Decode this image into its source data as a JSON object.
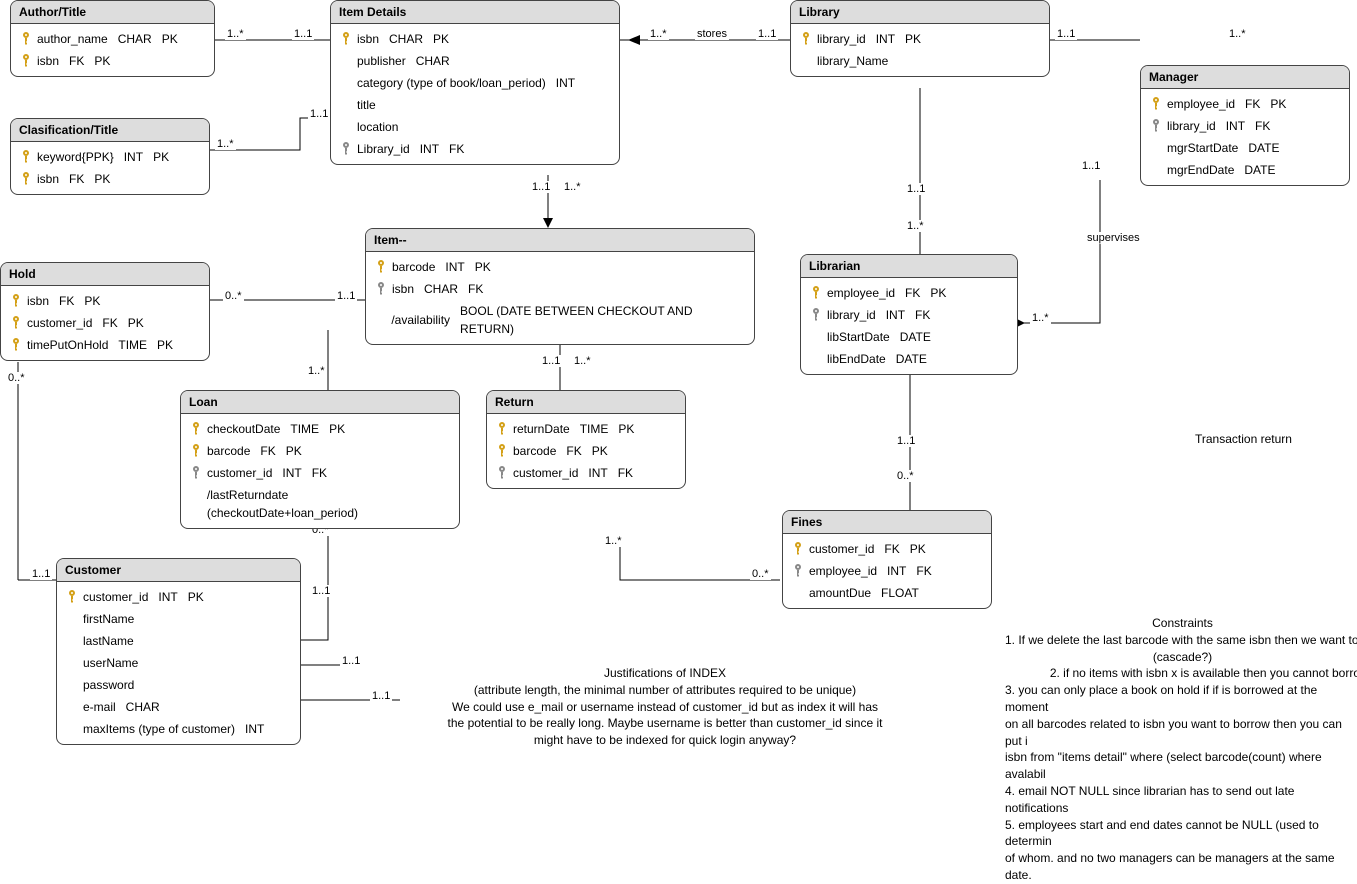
{
  "entities": {
    "authorTitle": {
      "title": "Author/Title",
      "attrs": [
        {
          "key": "pk",
          "name": "author_name",
          "type": "CHAR",
          "keys": "PK"
        },
        {
          "key": "pk",
          "name": "isbn",
          "type": "FK",
          "keys": "PK"
        }
      ]
    },
    "classificationTitle": {
      "title": "Clasification/Title",
      "attrs": [
        {
          "key": "pk",
          "name": "keyword{PPK}",
          "type": "INT",
          "keys": "PK"
        },
        {
          "key": "pk",
          "name": "isbn",
          "type": "FK",
          "keys": "PK"
        }
      ]
    },
    "itemDetails": {
      "title": "Item Details",
      "attrs": [
        {
          "key": "pk",
          "name": "isbn",
          "type": "CHAR",
          "keys": "PK"
        },
        {
          "key": "",
          "name": "publisher",
          "type": "CHAR",
          "keys": ""
        },
        {
          "key": "",
          "name": "category (type of book/loan_period)",
          "type": "INT",
          "keys": ""
        },
        {
          "key": "",
          "name": "title",
          "type": "",
          "keys": ""
        },
        {
          "key": "",
          "name": "location",
          "type": "",
          "keys": ""
        },
        {
          "key": "fk",
          "name": "Library_id",
          "type": "INT",
          "keys": "FK"
        }
      ]
    },
    "hold": {
      "title": "Hold",
      "attrs": [
        {
          "key": "pk",
          "name": "isbn",
          "type": "FK",
          "keys": "PK"
        },
        {
          "key": "pk",
          "name": "customer_id",
          "type": "FK",
          "keys": "PK"
        },
        {
          "key": "pk",
          "name": "timePutOnHold",
          "type": "TIME",
          "keys": "PK"
        }
      ]
    },
    "item": {
      "title": "Item--",
      "attrs": [
        {
          "key": "pk",
          "name": "barcode",
          "type": "INT",
          "keys": "PK"
        },
        {
          "key": "fk",
          "name": "isbn",
          "type": "CHAR",
          "keys": "FK"
        },
        {
          "key": "",
          "name": "/availability",
          "type": "BOOL (DATE BETWEEN CHECKOUT AND RETURN)",
          "keys": ""
        }
      ]
    },
    "loan": {
      "title": "Loan",
      "attrs": [
        {
          "key": "pk",
          "name": "checkoutDate",
          "type": "TIME",
          "keys": "PK"
        },
        {
          "key": "pk",
          "name": "barcode",
          "type": "FK",
          "keys": "PK"
        },
        {
          "key": "fk",
          "name": "customer_id",
          "type": "INT",
          "keys": "FK"
        },
        {
          "key": "",
          "name": "/lastReturndate (checkoutDate+loan_period)",
          "type": "",
          "keys": ""
        }
      ]
    },
    "return": {
      "title": "Return",
      "attrs": [
        {
          "key": "pk",
          "name": "returnDate",
          "type": "TIME",
          "keys": "PK"
        },
        {
          "key": "pk",
          "name": "barcode",
          "type": "FK",
          "keys": "PK"
        },
        {
          "key": "fk",
          "name": "customer_id",
          "type": "INT",
          "keys": "FK"
        }
      ]
    },
    "customer": {
      "title": "Customer",
      "attrs": [
        {
          "key": "pk",
          "name": "customer_id",
          "type": "INT",
          "keys": "PK"
        },
        {
          "key": "",
          "name": "firstName",
          "type": "",
          "keys": ""
        },
        {
          "key": "",
          "name": "lastName",
          "type": "",
          "keys": ""
        },
        {
          "key": "",
          "name": "userName",
          "type": "",
          "keys": ""
        },
        {
          "key": "",
          "name": "password",
          "type": "",
          "keys": ""
        },
        {
          "key": "",
          "name": "e-mail",
          "type": "CHAR",
          "keys": ""
        },
        {
          "key": "",
          "name": "maxItems (type of customer)",
          "type": "INT",
          "keys": ""
        }
      ]
    },
    "library": {
      "title": "Library",
      "attrs": [
        {
          "key": "pk",
          "name": "library_id",
          "type": "INT",
          "keys": "PK"
        },
        {
          "key": "",
          "name": "library_Name",
          "type": "",
          "keys": ""
        }
      ]
    },
    "librarian": {
      "title": "Librarian",
      "attrs": [
        {
          "key": "pk",
          "name": "employee_id",
          "type": "FK",
          "keys": "PK"
        },
        {
          "key": "fk",
          "name": "library_id",
          "type": "INT",
          "keys": "FK"
        },
        {
          "key": "",
          "name": "libStartDate",
          "type": "DATE",
          "keys": ""
        },
        {
          "key": "",
          "name": "libEndDate",
          "type": "DATE",
          "keys": ""
        }
      ]
    },
    "manager": {
      "title": "Manager",
      "attrs": [
        {
          "key": "pk",
          "name": "employee_id",
          "type": "FK",
          "keys": "PK"
        },
        {
          "key": "fk",
          "name": "library_id",
          "type": "INT",
          "keys": "FK"
        },
        {
          "key": "",
          "name": "mgrStartDate",
          "type": "DATE",
          "keys": ""
        },
        {
          "key": "",
          "name": "mgrEndDate",
          "type": "DATE",
          "keys": ""
        }
      ]
    },
    "fines": {
      "title": "Fines",
      "attrs": [
        {
          "key": "pk",
          "name": "customer_id",
          "type": "FK",
          "keys": "PK"
        },
        {
          "key": "fk",
          "name": "employee_id",
          "type": "INT",
          "keys": "FK"
        },
        {
          "key": "",
          "name": "amountDue",
          "type": "FLOAT",
          "keys": ""
        }
      ]
    }
  },
  "labels": {
    "stores": "stores",
    "supervises": "supervises",
    "transactionReturn": "Transaction return"
  },
  "cardinalities": {
    "c1": "1..*",
    "c2": "1..1",
    "c3": "0..*",
    "c4": "1..1",
    "c5": "1..*",
    "c6": "1..1",
    "c7": "1..*",
    "c8": "1..1",
    "c9": "0..*",
    "c10": "1..1",
    "c11": "1..*",
    "c12": "1..1",
    "c13": "1..*",
    "c14": "1..1",
    "c15": "1..*",
    "c16": "1..1",
    "c17": "0..*",
    "c18": "1..1",
    "c19": "0..*",
    "c20": "1..1",
    "c21": "1..*",
    "c22": "1..1",
    "c23": "1..1",
    "c24": "1..1",
    "c25": "1..1",
    "c26": "1..*",
    "c27": "1..*",
    "c28": "1..1",
    "c29": "1..1",
    "c30": "1..*"
  },
  "justifications": {
    "title": "Justifications of INDEX",
    "line1": "(attribute length, the  minimal  number  of   attributes  required to be unique)",
    "line2": "We could use e_mail or username instead of customer_id but as index it will has",
    "line3": "the potential to be really long. Maybe username is better than customer_id since it",
    "line4": "might have to be indexed for quick login anyway?"
  },
  "constraints": {
    "title": "Constraints",
    "line1": "1. If we delete the last barcode with the same isbn then we want to",
    "line1b": "(cascade?)",
    "line2": "2. if no items with isbn x is available then you cannot borro",
    "line3": "3. you can only place a book on hold if if is borrowed at the moment",
    "line3b": "on all barcodes related to isbn you want to borrow then you can put i",
    "line3c": "isbn from \"items detail\" where (select barcode(count) where avalabil",
    "line4": "4. email NOT NULL since librarian has to send out late notifications",
    "line5": "5. employees start and end dates cannot be NULL (used to determin",
    "line5b": "of whom. and no two managers can be managers at the same date."
  }
}
